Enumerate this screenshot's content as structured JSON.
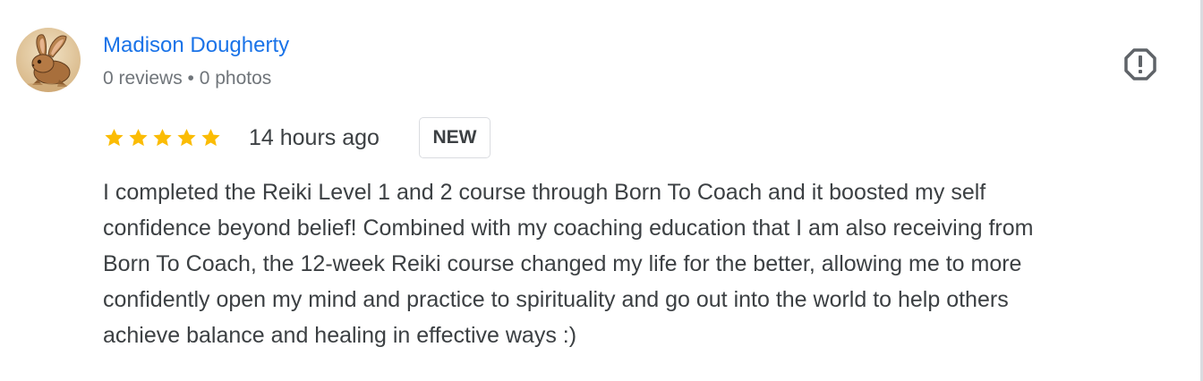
{
  "review": {
    "author": {
      "name": "Madison Dougherty",
      "meta": "0 reviews • 0 photos",
      "avatar_icon": "rabbit-avatar"
    },
    "rating": {
      "stars": 5,
      "max": 5,
      "color": "#fbbc04"
    },
    "time_ago": "14 hours ago",
    "badge": "NEW",
    "text_lines": [
      "I completed the Reiki Level 1 and 2 course through Born To Coach and it boosted my self",
      "confidence beyond belief! Combined with my coaching education that I am also receiving from",
      "Born To Coach, the 12-week Reiki course changed my life for the better, allowing me to more",
      "confidently open my mind and practice to spirituality and go out into the world to help others",
      "achieve balance and healing in effective ways :)"
    ],
    "report_icon": "report-flag-icon"
  },
  "colors": {
    "link": "#1a73e8",
    "text": "#3c4043",
    "muted": "#70757a",
    "star": "#fbbc04",
    "border": "#dadce0"
  }
}
